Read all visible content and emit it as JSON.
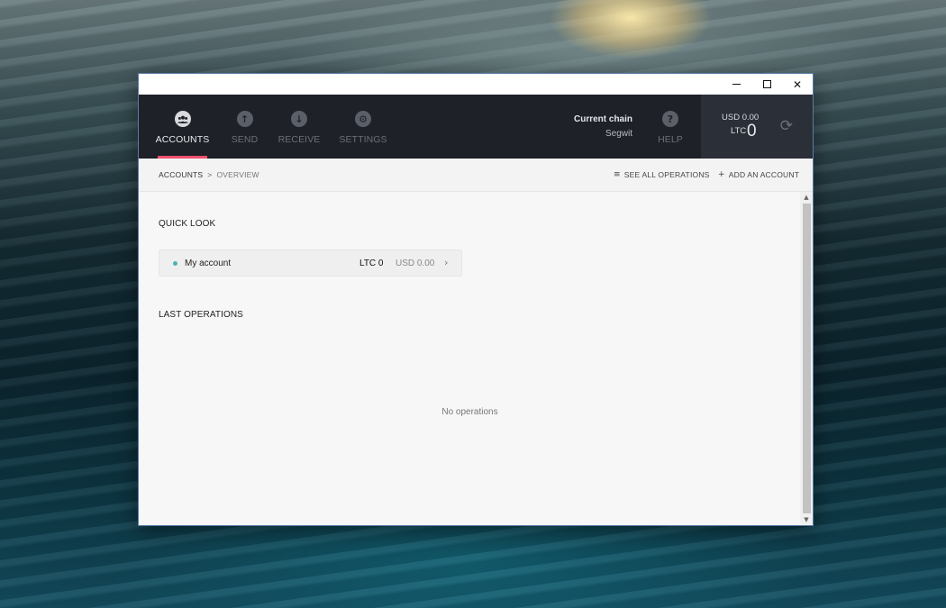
{
  "window": {
    "controls": {
      "minimize": "",
      "maximize": "",
      "close": "✕"
    }
  },
  "nav": {
    "items": [
      {
        "label": "ACCOUNTS",
        "icon": "accounts-icon",
        "glyph": "👥",
        "active": true
      },
      {
        "label": "SEND",
        "icon": "send-arrow-up-icon",
        "glyph": "↑",
        "active": false
      },
      {
        "label": "RECEIVE",
        "icon": "receive-arrow-down-icon",
        "glyph": "↓",
        "active": false
      },
      {
        "label": "SETTINGS",
        "icon": "gear-icon",
        "glyph": "⚙",
        "active": false
      }
    ],
    "chain_title": "Current chain",
    "chain_value": "Segwit",
    "help_label": "HELP",
    "help_glyph": "?",
    "accent_color": "#f0506e"
  },
  "balance": {
    "usd": "USD 0.00",
    "ltc_label": "LTC",
    "ltc_value": "0",
    "sync_glyph": "⟳"
  },
  "breadcrumb": {
    "root": "ACCOUNTS",
    "separator": ">",
    "current": "OVERVIEW"
  },
  "actions": {
    "see_all_icon": "≡",
    "see_all": "SEE ALL OPERATIONS",
    "add_account_icon": "+",
    "add_account": "ADD AN ACCOUNT"
  },
  "quick_look": {
    "title": "QUICK LOOK",
    "accounts": [
      {
        "name": "My account",
        "ltc": "LTC 0",
        "usd": "USD 0.00",
        "dot_color": "#4fb2b0",
        "chevron": "›"
      }
    ]
  },
  "last_operations": {
    "title": "LAST OPERATIONS",
    "empty_text": "No operations"
  },
  "scrollbar": {
    "up": "▲",
    "down": "▼"
  }
}
